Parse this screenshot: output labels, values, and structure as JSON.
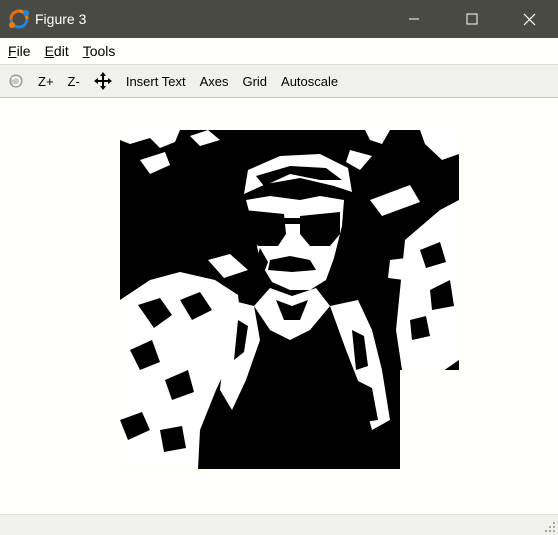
{
  "window": {
    "title": "Figure 3",
    "controls": [
      "minimize",
      "maximize",
      "close"
    ]
  },
  "menu": {
    "items": [
      {
        "mnemonic": "F",
        "rest": "ile"
      },
      {
        "mnemonic": "E",
        "rest": "dit"
      },
      {
        "mnemonic": "T",
        "rest": "ools"
      }
    ]
  },
  "toolbar": {
    "rotate_icon": "rotate-icon",
    "zoom_in": "Z+",
    "zoom_out": "Z-",
    "pan_icon": "pan-move-icon",
    "insert_text": "Insert Text",
    "axes": "Axes",
    "grid": "Grid",
    "autoscale": "Autoscale"
  },
  "figure": {
    "image": "binary-thresholded-portrait",
    "colors": {
      "ink": "#000000",
      "paper": "#ffffff"
    }
  },
  "colors": {
    "titlebar": "#4a4a44",
    "background": "#fffffb",
    "toolbar": "#f0f0ec"
  }
}
